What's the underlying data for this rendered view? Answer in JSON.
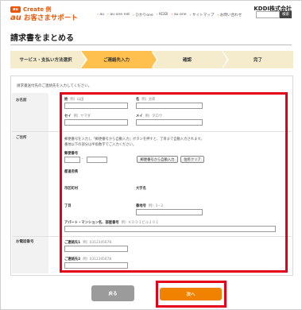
{
  "header": {
    "au_badge": "au",
    "create_text": "Create 例",
    "au_mark": "au",
    "support_text": "お客さまサポート",
    "company": "KDDI株式会社",
    "nav": [
      "au",
      "au one net",
      "ひかりone",
      "KDDI",
      "au one",
      "サイトマップ",
      "お問い合わせ"
    ],
    "search_button": "検索"
  },
  "page_title": "請求書をまとめる",
  "steps": [
    {
      "label": "サービス・支払い方法選択"
    },
    {
      "label": "ご連絡先入力"
    },
    {
      "label": "確認"
    },
    {
      "label": "完了"
    }
  ],
  "form": {
    "instruction": "請求書送付先のご連絡先を入力してください。",
    "name_section_label": "お名前",
    "sei_label": "姓",
    "sei_example": "例）山田",
    "mei_label": "名",
    "mei_example": "例）太郎",
    "sei_kana_label": "セイ",
    "sei_kana_example": "例）ヤマダ",
    "mei_kana_label": "メイ",
    "mei_kana_example": "例）タロウ",
    "address_section_label": "ご住所",
    "address_note_1": "郵便番号を入力し「郵便番号から自動入力」ボタンを押すと、丁目まで自動入力されます。",
    "address_note_2": "番地以下の部分は半角数字でご入力ください。",
    "postal_label": "郵便番号",
    "postal_separator": "-",
    "postal_autofill_button": "郵便番号から自動入力",
    "address_clear_button": "住所クリア",
    "prefecture_label": "都道府県",
    "city_label": "市区町村",
    "district_label": "大字名",
    "chome_label": "丁目",
    "banchi_label": "番地号",
    "banchi_example": "例）3－2",
    "building_label": "アパート・マンション名、部屋番号",
    "building_example": "例）ＫＤＤＩビル２０１",
    "phone_section_label": "お電話番号",
    "phone1_label": "ご連絡先1",
    "phone1_example": "例）0312345678",
    "phone2_label": "ご連絡先2",
    "phone2_example": "例）0312345678"
  },
  "buttons": {
    "back": "戻る",
    "next": "次へ"
  },
  "colors": {
    "brand_orange": "#eb5505",
    "active_step": "#ffc04d",
    "inactive_step": "#f4eccd",
    "next_button": "#f08200",
    "highlight_red": "#e4001b"
  }
}
